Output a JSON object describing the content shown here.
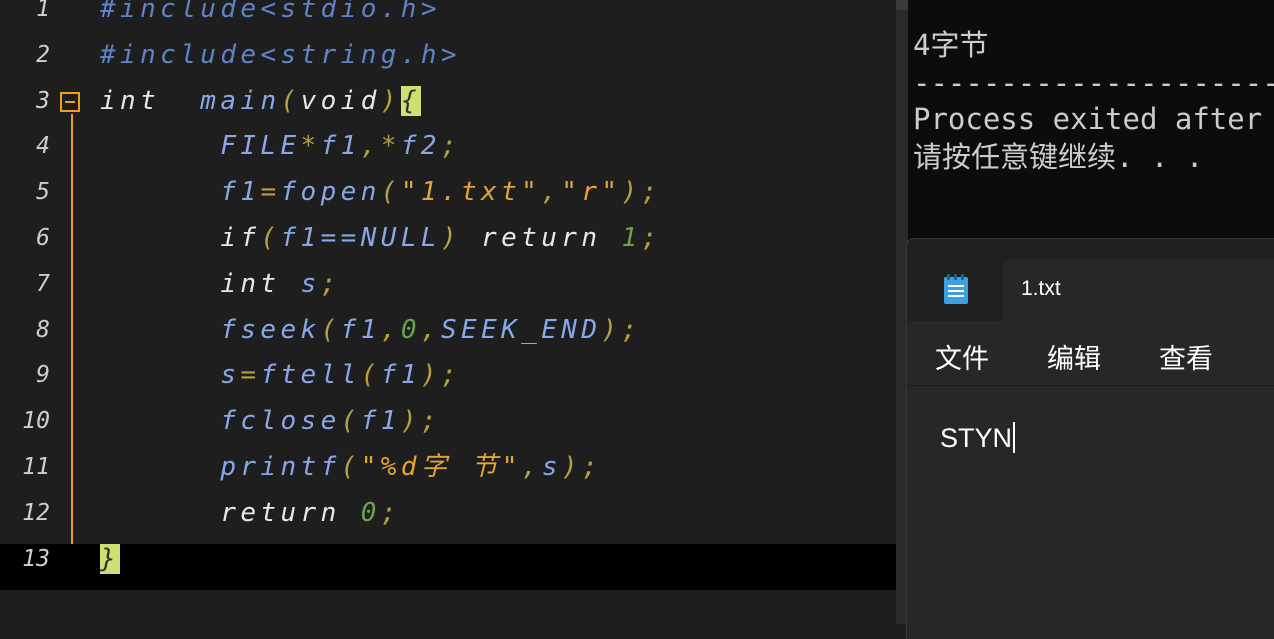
{
  "editor": {
    "line_numbers": [
      "1",
      "2",
      "3",
      "4",
      "5",
      "6",
      "7",
      "8",
      "9",
      "10",
      "11",
      "12",
      "13"
    ],
    "lines": [
      [
        {
          "t": "#include<stdio.h>",
          "c": "pp"
        }
      ],
      [
        {
          "t": "#include<string.h>",
          "c": "pp"
        }
      ],
      [
        {
          "t": "int",
          "c": "kw"
        },
        {
          "t": "  "
        },
        {
          "t": "main",
          "c": "id"
        },
        {
          "t": "(",
          "c": "op"
        },
        {
          "t": "void",
          "c": "kw"
        },
        {
          "t": ")",
          "c": "op"
        },
        {
          "t": "{",
          "c": "brk-hl"
        }
      ],
      [
        {
          "t": "      "
        },
        {
          "t": "FILE",
          "c": "id"
        },
        {
          "t": "*",
          "c": "op"
        },
        {
          "t": "f1",
          "c": "id"
        },
        {
          "t": ",*",
          "c": "op"
        },
        {
          "t": "f2",
          "c": "id"
        },
        {
          "t": ";",
          "c": "op"
        }
      ],
      [
        {
          "t": "      "
        },
        {
          "t": "f1",
          "c": "id"
        },
        {
          "t": "=",
          "c": "op"
        },
        {
          "t": "fopen",
          "c": "id"
        },
        {
          "t": "(",
          "c": "op"
        },
        {
          "t": "\"1.txt\"",
          "c": "str"
        },
        {
          "t": ",",
          "c": "op"
        },
        {
          "t": "\"r\"",
          "c": "str"
        },
        {
          "t": ");",
          "c": "op"
        }
      ],
      [
        {
          "t": "      "
        },
        {
          "t": "if",
          "c": "kw"
        },
        {
          "t": "(",
          "c": "op"
        },
        {
          "t": "f1==NULL",
          "c": "id"
        },
        {
          "t": ")",
          "c": "op"
        },
        {
          "t": " "
        },
        {
          "t": "return",
          "c": "kw"
        },
        {
          "t": " "
        },
        {
          "t": "1",
          "c": "num"
        },
        {
          "t": ";",
          "c": "op"
        }
      ],
      [
        {
          "t": "      "
        },
        {
          "t": "int",
          "c": "kw"
        },
        {
          "t": " "
        },
        {
          "t": "s",
          "c": "id"
        },
        {
          "t": ";",
          "c": "op"
        }
      ],
      [
        {
          "t": "      "
        },
        {
          "t": "fseek",
          "c": "id"
        },
        {
          "t": "(",
          "c": "op"
        },
        {
          "t": "f1",
          "c": "id"
        },
        {
          "t": ",",
          "c": "op"
        },
        {
          "t": "0",
          "c": "num"
        },
        {
          "t": ",",
          "c": "op"
        },
        {
          "t": "SEEK_END",
          "c": "id"
        },
        {
          "t": ");",
          "c": "op"
        }
      ],
      [
        {
          "t": "      "
        },
        {
          "t": "s",
          "c": "id"
        },
        {
          "t": "=",
          "c": "op"
        },
        {
          "t": "ftell",
          "c": "id"
        },
        {
          "t": "(",
          "c": "op"
        },
        {
          "t": "f1",
          "c": "id"
        },
        {
          "t": ");",
          "c": "op"
        }
      ],
      [
        {
          "t": "      "
        },
        {
          "t": "fclose",
          "c": "id"
        },
        {
          "t": "(",
          "c": "op"
        },
        {
          "t": "f1",
          "c": "id"
        },
        {
          "t": ");",
          "c": "op"
        }
      ],
      [
        {
          "t": "      "
        },
        {
          "t": "printf",
          "c": "id"
        },
        {
          "t": "(",
          "c": "op"
        },
        {
          "t": "\"%d字 节\"",
          "c": "str"
        },
        {
          "t": ",",
          "c": "op"
        },
        {
          "t": "s",
          "c": "id"
        },
        {
          "t": ");",
          "c": "op"
        }
      ],
      [
        {
          "t": "      "
        },
        {
          "t": "return",
          "c": "kw"
        },
        {
          "t": " "
        },
        {
          "t": "0",
          "c": "num"
        },
        {
          "t": ";",
          "c": "op"
        }
      ],
      [
        {
          "t": "}",
          "c": "brk-hl"
        }
      ]
    ],
    "current_line": 13
  },
  "console": {
    "lines": [
      "4字节",
      "--------------------------------",
      "Process exited after",
      "请按任意键继续. . ."
    ]
  },
  "notepad": {
    "tab_title": "1.txt",
    "menu": [
      "文件",
      "编辑",
      "查看"
    ],
    "content": "STYN",
    "icon": "notepad-icon"
  },
  "colors": {
    "preprocessor": "#5e84c8",
    "identifier": "#88a8e8",
    "number": "#6aa34a",
    "string": "#e4a23a",
    "fold_marker": "#f0a020",
    "bracket_highlight": "#d0e070"
  }
}
